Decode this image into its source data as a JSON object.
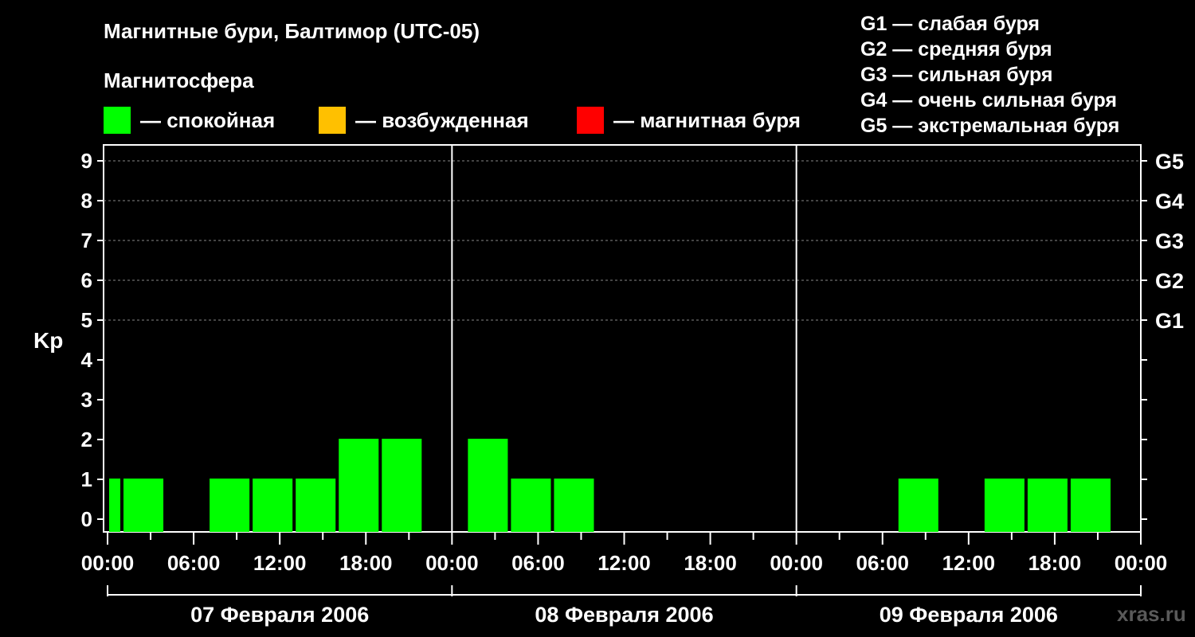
{
  "chart_data": {
    "type": "bar",
    "title": "Магнитные бури, Балтимор (UTC-05)",
    "subtitle": "Магнитосфера",
    "ylabel": "Kp",
    "ylim": [
      0,
      9
    ],
    "y_ticks": [
      "0",
      "1",
      "2",
      "3",
      "4",
      "5",
      "6",
      "7",
      "8",
      "9"
    ],
    "right_ticks": [
      {
        "kp": 5,
        "label": "G1"
      },
      {
        "kp": 6,
        "label": "G2"
      },
      {
        "kp": 7,
        "label": "G3"
      },
      {
        "kp": 8,
        "label": "G4"
      },
      {
        "kp": 9,
        "label": "G5"
      }
    ],
    "x_tick_labels": [
      "00:00",
      "06:00",
      "12:00",
      "18:00",
      "00:00",
      "06:00",
      "12:00",
      "18:00",
      "00:00",
      "06:00",
      "12:00",
      "18:00",
      "00:00"
    ],
    "days": [
      "07 Февраля 2006",
      "08 Февраля 2006",
      "09 Февраля 2006"
    ],
    "grid": "dashed horizontal at 5-9",
    "legend": [
      {
        "label": "— спокойная",
        "color": "#00ff00"
      },
      {
        "label": "— возбужденная",
        "color": "#ffc000"
      },
      {
        "label": "— магнитная буря",
        "color": "#ff0000"
      }
    ],
    "series": [
      {
        "values": [
          {
            "day": 0,
            "start_hour": 0,
            "end_hour": 1,
            "kp": 1
          },
          {
            "day": 0,
            "start_hour": 1,
            "end_hour": 4,
            "kp": 1
          },
          {
            "day": 0,
            "start_hour": 7,
            "end_hour": 10,
            "kp": 1
          },
          {
            "day": 0,
            "start_hour": 10,
            "end_hour": 13,
            "kp": 1
          },
          {
            "day": 0,
            "start_hour": 13,
            "end_hour": 16,
            "kp": 1
          },
          {
            "day": 0,
            "start_hour": 16,
            "end_hour": 19,
            "kp": 2
          },
          {
            "day": 0,
            "start_hour": 19,
            "end_hour": 22,
            "kp": 2
          },
          {
            "day": 1,
            "start_hour": 1,
            "end_hour": 4,
            "kp": 2
          },
          {
            "day": 1,
            "start_hour": 4,
            "end_hour": 7,
            "kp": 1
          },
          {
            "day": 1,
            "start_hour": 7,
            "end_hour": 10,
            "kp": 1
          },
          {
            "day": 2,
            "start_hour": 7,
            "end_hour": 10,
            "kp": 1
          },
          {
            "day": 2,
            "start_hour": 13,
            "end_hour": 16,
            "kp": 1
          },
          {
            "day": 2,
            "start_hour": 16,
            "end_hour": 19,
            "kp": 1
          },
          {
            "day": 2,
            "start_hour": 19,
            "end_hour": 22,
            "kp": 1
          }
        ]
      }
    ]
  },
  "g_scale": [
    "G1 — слабая буря",
    "G2 — средняя буря",
    "G3 — сильная буря",
    "G4 — очень сильная буря",
    "G5 — экстремальная буря"
  ],
  "watermark": "xras.ru"
}
